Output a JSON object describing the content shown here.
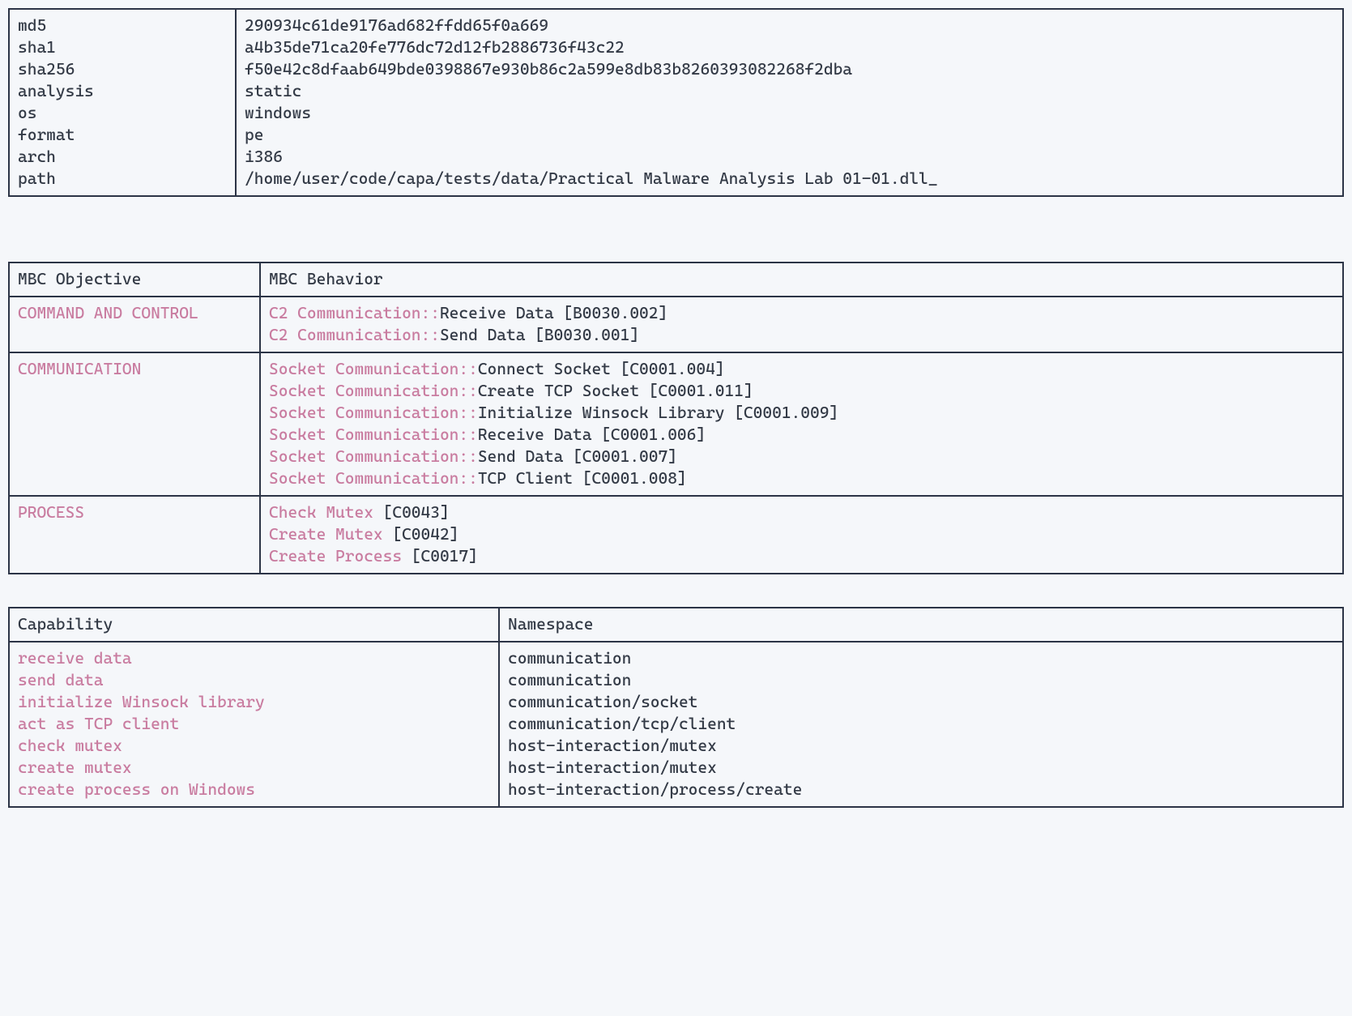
{
  "metadata": {
    "rows": [
      {
        "key": "md5",
        "value": "290934c61de9176ad682ffdd65f0a669"
      },
      {
        "key": "sha1",
        "value": "a4b35de71ca20fe776dc72d12fb2886736f43c22"
      },
      {
        "key": "sha256",
        "value": "f50e42c8dfaab649bde0398867e930b86c2a599e8db83b8260393082268f2dba"
      },
      {
        "key": "analysis",
        "value": "static"
      },
      {
        "key": "os",
        "value": "windows"
      },
      {
        "key": "format",
        "value": "pe"
      },
      {
        "key": "arch",
        "value": "i386"
      },
      {
        "key": "path",
        "value": "/home/user/code/capa/tests/data/Practical Malware Analysis Lab 01-01.dll_"
      }
    ]
  },
  "mbc": {
    "headers": {
      "objective": "MBC Objective",
      "behavior": "MBC Behavior"
    },
    "rows": [
      {
        "objective": "COMMAND AND CONTROL",
        "behaviors": [
          {
            "category": "C2 Communication::",
            "detail": "Receive Data [B0030.002]"
          },
          {
            "category": "C2 Communication::",
            "detail": "Send Data [B0030.001]"
          }
        ]
      },
      {
        "objective": "COMMUNICATION",
        "behaviors": [
          {
            "category": "Socket Communication::",
            "detail": "Connect Socket [C0001.004]"
          },
          {
            "category": "Socket Communication::",
            "detail": "Create TCP Socket [C0001.011]"
          },
          {
            "category": "Socket Communication::",
            "detail": "Initialize Winsock Library [C0001.009]"
          },
          {
            "category": "Socket Communication::",
            "detail": "Receive Data [C0001.006]"
          },
          {
            "category": "Socket Communication::",
            "detail": "Send Data [C0001.007]"
          },
          {
            "category": "Socket Communication::",
            "detail": "TCP Client [C0001.008]"
          }
        ]
      },
      {
        "objective": "PROCESS",
        "behaviors": [
          {
            "category": "Check Mutex ",
            "detail": "[C0043]"
          },
          {
            "category": "Create Mutex ",
            "detail": "[C0042]"
          },
          {
            "category": "Create Process ",
            "detail": "[C0017]"
          }
        ]
      }
    ]
  },
  "capabilities": {
    "headers": {
      "capability": "Capability",
      "namespace": "Namespace"
    },
    "rows": [
      {
        "cap": "receive data",
        "ns": "communication"
      },
      {
        "cap": "send data",
        "ns": "communication"
      },
      {
        "cap": "initialize Winsock library",
        "ns": "communication/socket"
      },
      {
        "cap": "act as TCP client",
        "ns": "communication/tcp/client"
      },
      {
        "cap": "check mutex",
        "ns": "host-interaction/mutex"
      },
      {
        "cap": "create mutex",
        "ns": "host-interaction/mutex"
      },
      {
        "cap": "create process on Windows",
        "ns": "host-interaction/process/create"
      }
    ]
  }
}
